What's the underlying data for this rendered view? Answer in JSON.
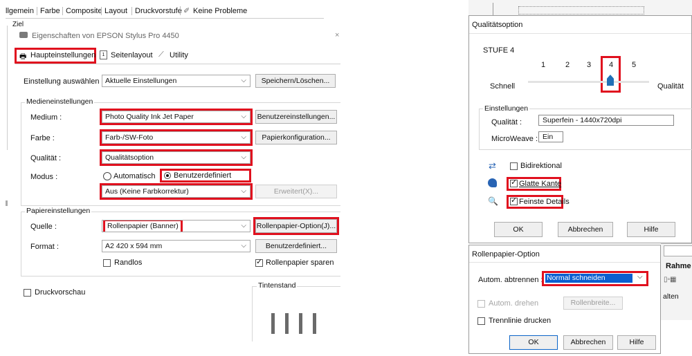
{
  "left_window": {
    "top_tabs": [
      "llgemein",
      "Farbe",
      "Composite",
      "Layout",
      "Druckvorstufe",
      "Keine Probleme"
    ],
    "ziel_label": "Ziel",
    "dialog_title": "Eigenschaften von EPSON Stylus Pro 4450",
    "tabs": [
      "Haupteinstellungen",
      "Seitenlayout",
      "Utility"
    ],
    "setting_label": "Einstellung auswählen :",
    "setting_value": "Aktuelle Einstellungen",
    "save_button": "Speichern/Löschen...",
    "media_group": "Medieneinstellungen",
    "medium_label": "Medium :",
    "medium_value": "Photo Quality Ink Jet Paper",
    "user_settings_button": "Benutzereinstellungen...",
    "color_label": "Farbe :",
    "color_value": "Farb-/SW-Foto",
    "paper_config_button": "Papierkonfiguration...",
    "quality_label": "Qualität :",
    "quality_value": "Qualitätsoption",
    "mode_label": "Modus :",
    "mode_auto": "Automatisch",
    "mode_custom": "Benutzerdefiniert",
    "mode_value": "Aus (Keine Farbkorrektur)",
    "advanced_button": "Erweitert(X)...",
    "paper_group": "Papiereinstellungen",
    "source_label": "Quelle :",
    "source_value": "Rollenpapier (Banner)",
    "roll_option_button": "Rollenpapier-Option(J)...",
    "format_label": "Format :",
    "format_value": "A2 420 x 594 mm",
    "custom_format_button": "Benutzerdefiniert...",
    "borderless": "Randlos",
    "save_roll": "Rollenpapier sparen",
    "preview": "Druckvorschau",
    "ink_group": "Tintenstand"
  },
  "quality_dialog": {
    "title": "Qualitätsoption",
    "level": "STUFE 4",
    "ticks": [
      "1",
      "2",
      "3",
      "4",
      "5"
    ],
    "slider_value": 4,
    "fast": "Schnell",
    "quality": "Qualität",
    "settings_group": "Einstellungen",
    "quality_label": "Qualität :",
    "quality_value": "Superfein - 1440x720dpi",
    "microweave_label": "MicroWeave :",
    "microweave_value": "Ein",
    "bidirectional": "Bidirektional",
    "smooth_edge": "Glatte Kante",
    "finest_detail": "Feinste Details",
    "ok": "OK",
    "cancel": "Abbrechen",
    "help": "Hilfe"
  },
  "roll_dialog": {
    "title": "Rollenpapier-Option",
    "cut_label": "Autom. abtrennen :",
    "cut_value": "Normal schneiden",
    "auto_rotate": "Autom. drehen",
    "roll_width_button": "Rollenbreite...",
    "print_line": "Trennlinie drucken",
    "ok": "OK",
    "cancel": "Abbrechen",
    "help": "Hilfe"
  },
  "background": {
    "rahmen": "Rahme",
    "alten": "alten"
  },
  "colors": {
    "highlight": "#e0101e",
    "slider_thumb": "#1f6fb6",
    "selection": "#0b5fd0"
  }
}
